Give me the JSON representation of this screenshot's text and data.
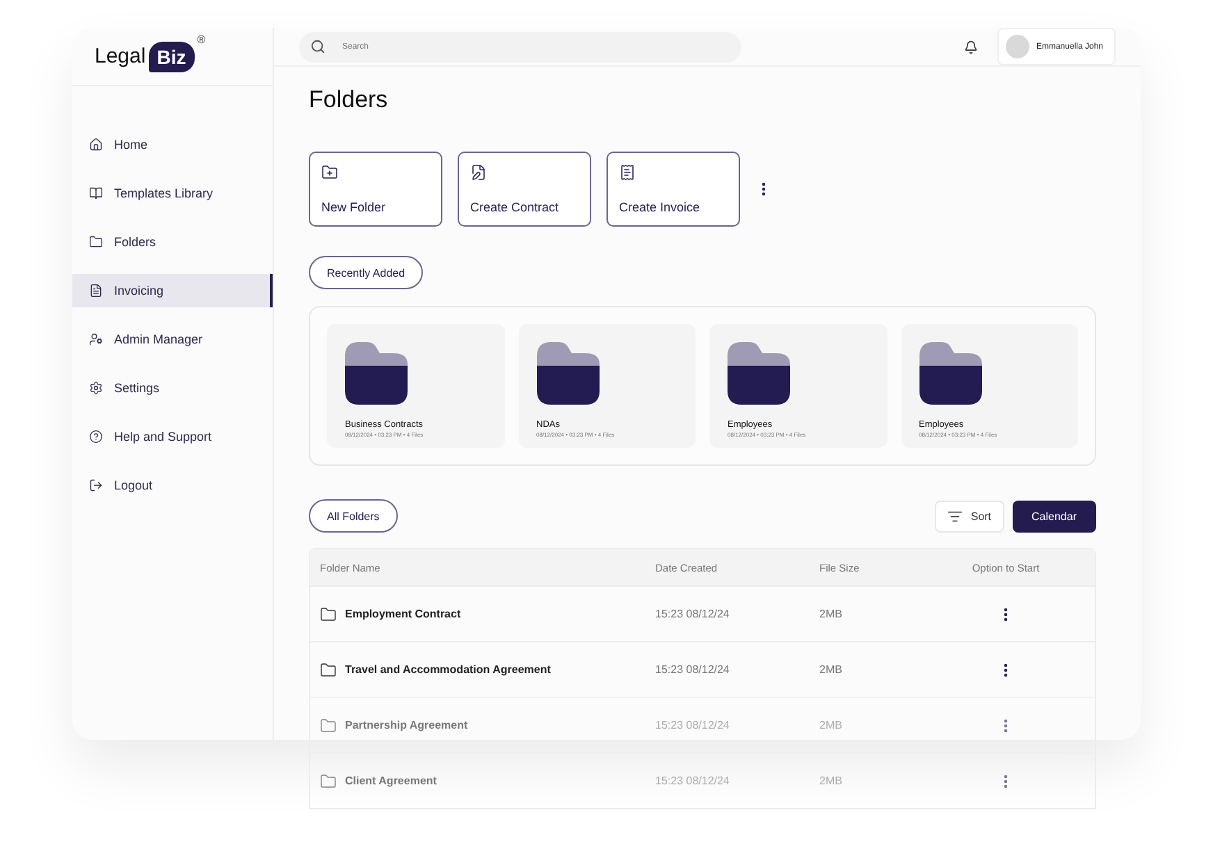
{
  "logo": {
    "word": "Legal",
    "badge": "Biz",
    "mark": "®"
  },
  "sidebar": {
    "items": [
      {
        "label": "Home",
        "selected": false
      },
      {
        "label": "Templates Library",
        "selected": false
      },
      {
        "label": "Folders",
        "selected": false
      },
      {
        "label": "Invoicing",
        "selected": true
      },
      {
        "label": "Admin Manager",
        "selected": false
      },
      {
        "label": "Settings",
        "selected": false
      },
      {
        "label": "Help and Support",
        "selected": false
      },
      {
        "label": "Logout",
        "selected": false
      }
    ]
  },
  "search": {
    "placeholder": "Search"
  },
  "user": {
    "name": "Emmanuella John"
  },
  "page_title": "Folders",
  "actions": [
    {
      "label": "New Folder"
    },
    {
      "label": "Create Contract"
    },
    {
      "label": "Create Invoice"
    }
  ],
  "recent": {
    "label": "Recently Added",
    "folders": [
      {
        "name": "Business Contracts",
        "meta": "08/12/2024 • 03:23 PM • 4 Files"
      },
      {
        "name": "NDAs",
        "meta": "08/12/2024 • 03:23 PM • 4 Files"
      },
      {
        "name": "Employees",
        "meta": "08/12/2024 • 03:23 PM • 4 Files"
      },
      {
        "name": "Employees",
        "meta": "08/12/2024 • 03:23 PM • 4 Files"
      }
    ]
  },
  "all_folders": {
    "label": "All Folders",
    "sort": "Sort",
    "calendar": "Calendar"
  },
  "table": {
    "columns": [
      "Folder Name",
      "Date Created",
      "File Size",
      "Option to Start"
    ],
    "rows": [
      {
        "name": "Employment Contract",
        "date": "15:23 08/12/24",
        "size": "2MB",
        "faded": false
      },
      {
        "name": "Travel and Accommodation Agreement",
        "date": "15:23 08/12/24",
        "size": "2MB",
        "faded": false
      },
      {
        "name": "Partnership Agreement",
        "date": "15:23 08/12/24",
        "size": "2MB",
        "faded": true
      },
      {
        "name": "Client Agreement",
        "date": "15:23 08/12/24",
        "size": "2MB",
        "faded": true
      }
    ]
  }
}
